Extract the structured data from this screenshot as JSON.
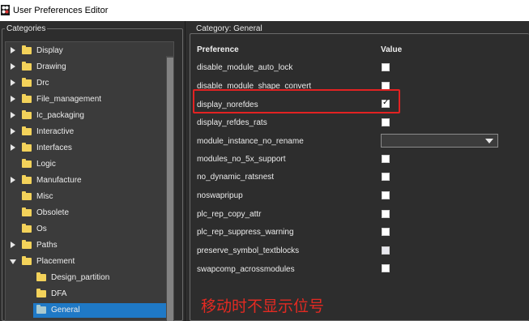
{
  "window": {
    "title": "User Preferences Editor"
  },
  "left_panel": {
    "group_label": "Categories",
    "tree": [
      {
        "label": "Display",
        "expanded": false,
        "level": 0
      },
      {
        "label": "Drawing",
        "expanded": false,
        "level": 0
      },
      {
        "label": "Drc",
        "expanded": false,
        "level": 0
      },
      {
        "label": "File_management",
        "expanded": false,
        "level": 0
      },
      {
        "label": "Ic_packaging",
        "expanded": false,
        "level": 0
      },
      {
        "label": "Interactive",
        "expanded": false,
        "level": 0
      },
      {
        "label": "Interfaces",
        "expanded": false,
        "level": 0
      },
      {
        "label": "Logic",
        "expanded": false,
        "level": 0
      },
      {
        "label": "Manufacture",
        "expanded": false,
        "level": 0
      },
      {
        "label": "Misc",
        "expanded": false,
        "level": 0
      },
      {
        "label": "Obsolete",
        "expanded": false,
        "level": 0
      },
      {
        "label": "Os",
        "expanded": false,
        "level": 0
      },
      {
        "label": "Paths",
        "expanded": false,
        "level": 0
      },
      {
        "label": "Placement",
        "expanded": true,
        "level": 0
      },
      {
        "label": "Design_partition",
        "level": 1
      },
      {
        "label": "DFA",
        "level": 1
      },
      {
        "label": "General",
        "level": 1,
        "selected": true
      }
    ]
  },
  "right_panel": {
    "group_label": "Category:  General",
    "columns": {
      "preference": "Preference",
      "value": "Value"
    },
    "rows": [
      {
        "name": "disable_module_auto_lock",
        "value": "checkbox",
        "checked": false
      },
      {
        "name": "disable_module_shape_convert",
        "value": "checkbox",
        "checked": false
      },
      {
        "name": "display_norefdes",
        "value": "checkbox",
        "checked": true
      },
      {
        "name": "display_refdes_rats",
        "value": "checkbox",
        "checked": false
      },
      {
        "name": "module_instance_no_rename",
        "value": "dropdown",
        "selected": ""
      },
      {
        "name": "modules_no_5x_support",
        "value": "checkbox",
        "checked": false
      },
      {
        "name": "no_dynamic_ratsnest",
        "value": "checkbox",
        "checked": false
      },
      {
        "name": "noswapripup",
        "value": "checkbox",
        "checked": false
      },
      {
        "name": "plc_rep_copy_attr",
        "value": "checkbox",
        "checked": false
      },
      {
        "name": "plc_rep_suppress_warning",
        "value": "checkbox",
        "checked": false
      },
      {
        "name": "preserve_symbol_textblocks",
        "value": "checkbox",
        "checked": false,
        "partial": true
      },
      {
        "name": "swapcomp_acrossmodules",
        "value": "checkbox",
        "checked": false
      }
    ]
  },
  "annotation": {
    "text": "移动时不显示位号",
    "color": "#e32a22"
  },
  "colors": {
    "highlight_box": "#e32222",
    "selection": "#1f79c6",
    "folder": "#f3d25a"
  }
}
